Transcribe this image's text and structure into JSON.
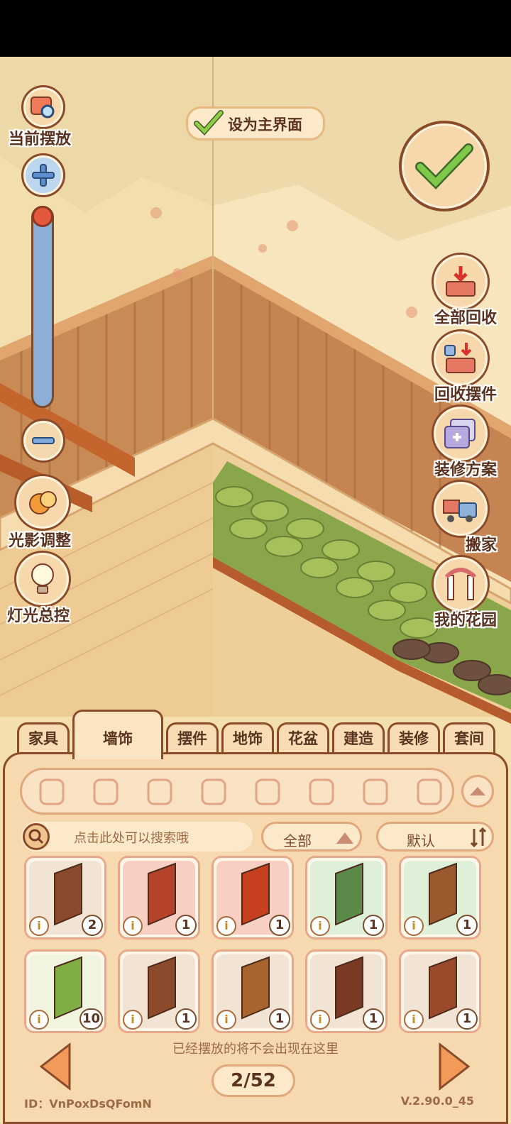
{
  "top_left": {
    "current_placement_label": "当前摆放",
    "light_shadow_label": "光影调整",
    "light_control_label": "灯光总控"
  },
  "set_main": {
    "label": "设为主界面"
  },
  "zoom": {
    "level": 0.0
  },
  "right_menu": {
    "items": [
      {
        "label": "全部回收",
        "icon": "box-recycle-icon"
      },
      {
        "label": "回收摆件",
        "icon": "box-cup-recycle-icon"
      },
      {
        "label": "装修方案",
        "icon": "plan-cards-icon"
      },
      {
        "label": "搬家",
        "icon": "moving-truck-icon"
      },
      {
        "label": "我的花园",
        "icon": "garden-arch-icon"
      }
    ]
  },
  "tabs": [
    {
      "label": "家具"
    },
    {
      "label": "墙饰"
    },
    {
      "label": "摆件"
    },
    {
      "label": "地饰"
    },
    {
      "label": "花盆"
    },
    {
      "label": "建造"
    },
    {
      "label": "装修"
    },
    {
      "label": "套间"
    }
  ],
  "active_tab": "墙饰",
  "category_icons": [
    "hook-icon",
    "utensil-rack-icon",
    "shower-icon",
    "wall-lamp-icon",
    "bubble-icon",
    "air-conditioner-icon",
    "paw-lamp-icon",
    "towel-icon"
  ],
  "search": {
    "placeholder": "点击此处可以搜索哦"
  },
  "filter": {
    "label": "全部"
  },
  "sort": {
    "label": "默认"
  },
  "items": [
    {
      "count": "2",
      "color": "#8b4a2b",
      "bg": "#f2e4d4",
      "icon": "wooden-window-icon"
    },
    {
      "count": "1",
      "color": "#b5432c",
      "bg": "#f7cfc3",
      "icon": "autumn-window-icon"
    },
    {
      "count": "1",
      "color": "#c6401f",
      "bg": "#f7cfc3",
      "icon": "red-leaves-icon"
    },
    {
      "count": "1",
      "color": "#5b8a4b",
      "bg": "#dff0d9",
      "icon": "moss-stone-icon"
    },
    {
      "count": "1",
      "color": "#9a5a2e",
      "bg": "#dff0d9",
      "icon": "wall-shelf-icon"
    },
    {
      "count": "10",
      "color": "#7fae45",
      "bg": "#f1f5df",
      "icon": "hedge-icon"
    },
    {
      "count": "1",
      "color": "#8b4a2b",
      "bg": "#f2e4d4",
      "icon": "arched-door-icon"
    },
    {
      "count": "1",
      "color": "#a8662e",
      "bg": "#f2e4d4",
      "icon": "photo-wall-icon"
    },
    {
      "count": "1",
      "color": "#7a3a23",
      "bg": "#f2e4d4",
      "icon": "stair-window-icon"
    },
    {
      "count": "1",
      "color": "#9a4a2a",
      "bg": "#f2e4d4",
      "icon": "cabinet-window-icon"
    }
  ],
  "notice": "已经摆放的将不会出现在这里",
  "pager": {
    "text": "2/52"
  },
  "footer": {
    "id": "ID：VnPoxDsQFomN",
    "version": "V.2.90.0_45"
  }
}
